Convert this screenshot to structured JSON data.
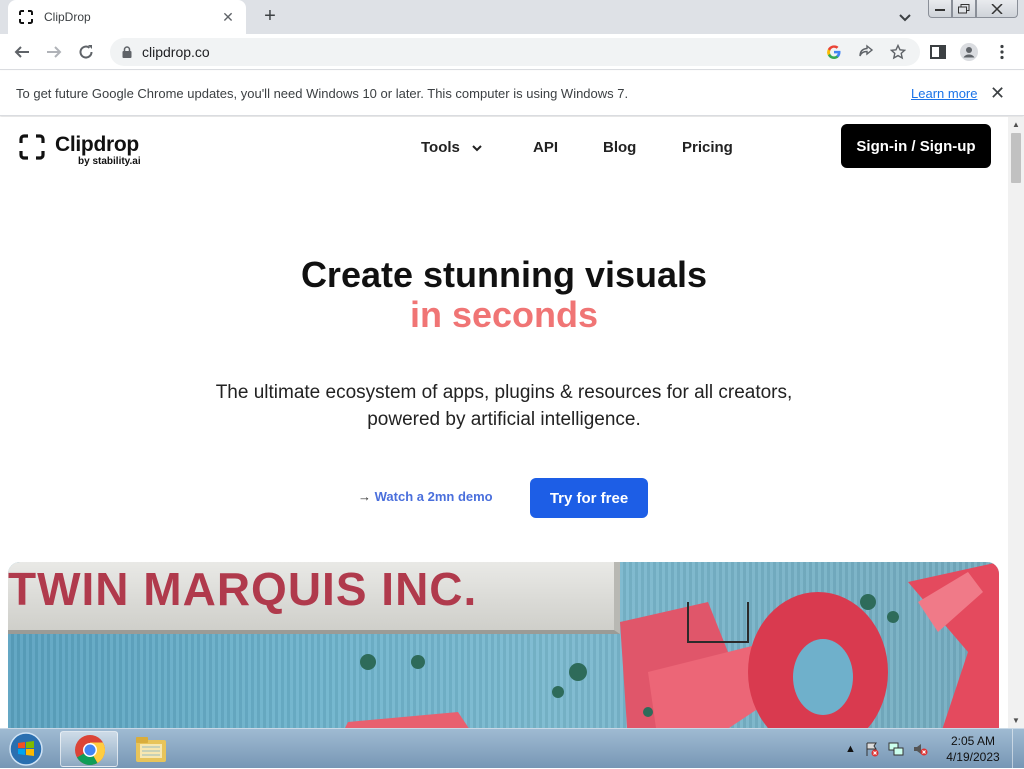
{
  "browser": {
    "tab_title": "ClipDrop",
    "new_tab_label": "+",
    "tab_close": "✕",
    "url": "clipdrop.co"
  },
  "infobar": {
    "message": "To get future Google Chrome updates, you'll need Windows 10 or later. This computer is using Windows 7.",
    "link": "Learn more",
    "close": "✕"
  },
  "site": {
    "logo_name": "Clipdrop",
    "logo_sub": "by stability.ai",
    "nav": [
      "Tools",
      "API",
      "Blog",
      "Pricing"
    ],
    "signin": "Sign-in / Sign-up",
    "hero_title": "Create stunning visuals",
    "hero_accent": "in seconds",
    "hero_sub_line1": "The ultimate ecosystem of apps, plugins & resources for all creators,",
    "hero_sub_line2": "powered by artificial intelligence.",
    "demo_arrow": "→",
    "demo_link": "Watch a 2mn demo",
    "cta": "Try for free",
    "image_sign_text": "TWIN MARQUIS INC.",
    "colors": {
      "accent": "#f07575",
      "cta": "#1d5ee6",
      "link": "#4a6fdc"
    }
  },
  "taskbar": {
    "time": "2:05 AM",
    "date": "4/19/2023"
  }
}
